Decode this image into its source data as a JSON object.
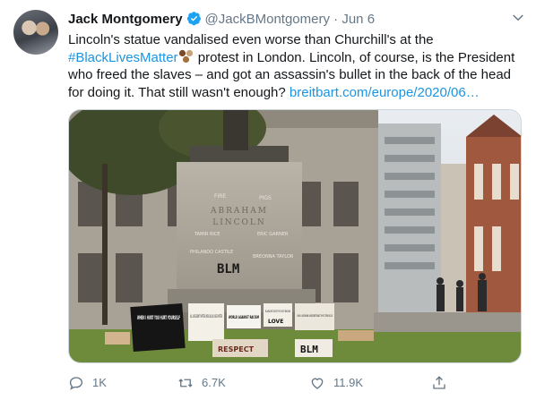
{
  "tweet": {
    "author_name": "Jack Montgomery",
    "handle": "@JackBMontgomery",
    "separator": "·",
    "date": "Jun 6",
    "text_part1": "Lincoln's statue vandalised even worse than Churchill's at the ",
    "hashtag": "#BlackLivesMatter",
    "text_part2": " protest in London. Lincoln, of course, is the President who freed the slaves – and got an assassin's bullet in the back of the head for doing it. That still wasn't enough? ",
    "link": "breitbart.com/europe/2020/06…"
  },
  "photo": {
    "plinth_top_text": "ABRAHAM",
    "plinth_mid_text": "LINCOLN",
    "graffiti_main": "BLM",
    "graffiti_1": "FIRE",
    "graffiti_2": "PIGS",
    "graffiti_3": "TAMIR RICE",
    "graffiti_4": "ERIC GARNER",
    "graffiti_5": "PHILANDO CASTILE",
    "graffiti_6": "BREONNA TAYLOR",
    "sign_1": "WHEN I HURT YOU HURT YOURSELF",
    "sign_2": "ALL LIVES DON'T MATTER UNTIL BLACK LIVES MATTER",
    "sign_3": "WORLD AGAINST RACISM",
    "sign_4": "IN A RACIST SOCIETY IT IS NOT ENOUGH",
    "sign_5": "LOVE",
    "sign_6": "I AM A WOMAN UNDERSTAND THE STRUGGLE",
    "sign_7": "RESPECT",
    "sign_8": "BLM"
  },
  "actions": {
    "reply_count": "1K",
    "retweet_count": "6.7K",
    "like_count": "11.9K"
  },
  "icons": [
    "verified-badge-icon",
    "chevron-down-icon",
    "reply-icon",
    "retweet-icon",
    "like-icon",
    "share-icon",
    "raised-fist-emoji-icon"
  ],
  "colors": {
    "link": "#1b95e0",
    "muted": "#657786",
    "text": "#14171a",
    "verified": "#1da1f2"
  }
}
